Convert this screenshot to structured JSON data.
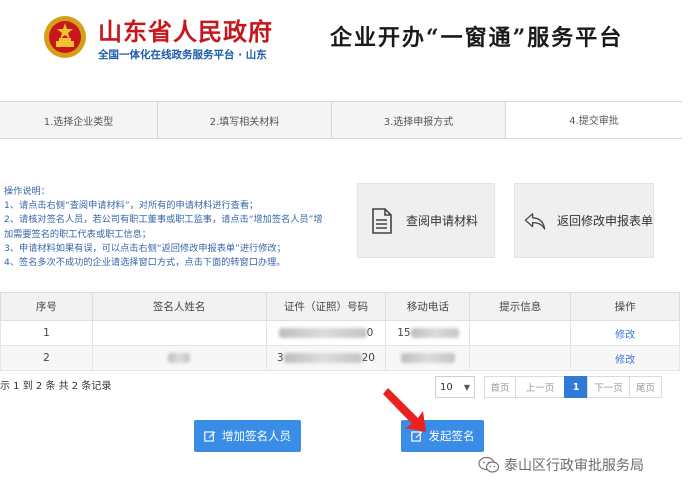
{
  "header": {
    "brand_title": "山东省人民政府",
    "brand_subtitle": "全国一体化在线政务服务平台 · 山东",
    "platform_title": "企业开办“一窗通”服务平台"
  },
  "steps": [
    {
      "label": "1.选择企业类型"
    },
    {
      "label": "2.填写相关材料"
    },
    {
      "label": "3.选择申报方式"
    },
    {
      "label": "4.提交审批"
    }
  ],
  "instructions": {
    "title": "操作说明：",
    "lines": [
      "1、请点击右侧“查阅申请材料”，对所有的申请材料进行查看；",
      "2、请核对签名人员，若公司有职工董事或职工监事，请点击“增加签名人员”增",
      "加需要签名的职工代表或职工信息；",
      "3、申请材料如果有误，可以点击右侧“返回修改申报表单”进行修改；",
      "4、签名多次不成功的企业请选择窗口方式，点击下面的转窗口办理。"
    ]
  },
  "actions": {
    "view_materials": "查阅申请材料",
    "back_edit": "返回修改申报表单"
  },
  "table": {
    "headers": [
      "序号",
      "签名人姓名",
      "证件（证照）号码",
      "移动电话",
      "提示信息",
      "操作"
    ],
    "rows": [
      {
        "index": "1",
        "id_start": "",
        "id_end": "0",
        "phone_start": "15",
        "phone_end": "",
        "action": "修改"
      },
      {
        "index": "2",
        "id_start": "3",
        "id_end": "20",
        "phone_start": "",
        "phone_end": "",
        "action": "修改"
      }
    ]
  },
  "pagination": {
    "records_text": "示 1 到 2 条 共 2 条记录",
    "page_size": "10",
    "first": "首页",
    "prev": "上一页",
    "current": "1",
    "next": "下一页",
    "last": "尾页"
  },
  "buttons": {
    "add_signer": "增加签名人员",
    "start_sign": "发起签名"
  },
  "watermark": "泰山区行政审批服务局",
  "colors": {
    "brand_red": "#c8161d",
    "brand_blue": "#1a5ca8",
    "accent": "#3a8de6",
    "instruction_text": "#3565a8"
  },
  "icons": {
    "emblem": "national-emblem-icon",
    "view": "document-icon",
    "back": "return-arrow-icon",
    "edit": "edit-icon",
    "wechat": "wechat-icon"
  }
}
